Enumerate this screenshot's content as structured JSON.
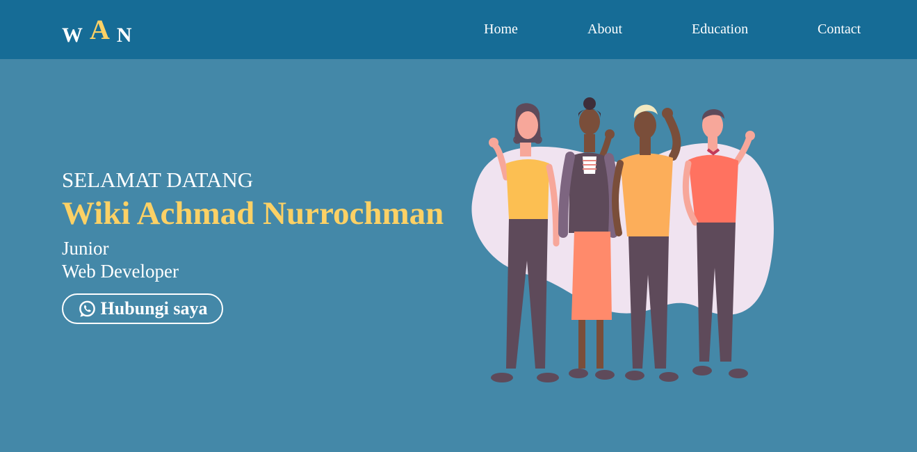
{
  "logo": {
    "w": "W",
    "a": "A",
    "n": "N"
  },
  "nav": {
    "items": [
      {
        "label": "Home"
      },
      {
        "label": "About"
      },
      {
        "label": "Education"
      },
      {
        "label": "Contact"
      }
    ]
  },
  "hero": {
    "greeting": "SELAMAT DATANG",
    "name": "Wiki Achmad Nurrochman",
    "role_line1": "Junior",
    "role_line2": "Web Developer",
    "button_label": "Hubungi saya",
    "button_icon": "whatsapp-icon"
  },
  "colors": {
    "navbar": "#166c96",
    "background": "#4488a8",
    "accent": "#fcd165",
    "text": "#ffffff"
  }
}
